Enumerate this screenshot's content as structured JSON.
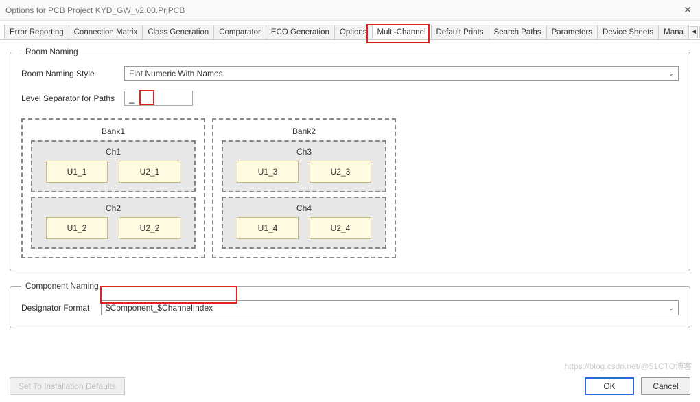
{
  "window": {
    "title": "Options for PCB Project KYD_GW_v2.00.PrjPCB"
  },
  "tabs": [
    "Error Reporting",
    "Connection Matrix",
    "Class Generation",
    "Comparator",
    "ECO Generation",
    "Options",
    "Multi-Channel",
    "Default Prints",
    "Search Paths",
    "Parameters",
    "Device Sheets",
    "Mana"
  ],
  "roomNaming": {
    "legend": "Room Naming",
    "styleLabel": "Room Naming Style",
    "styleValue": "Flat Numeric With Names",
    "sepLabel": "Level Separator for Paths",
    "sepValue": "_",
    "banks": [
      {
        "title": "Bank1",
        "channels": [
          {
            "title": "Ch1",
            "items": [
              "U1_1",
              "U2_1"
            ]
          },
          {
            "title": "Ch2",
            "items": [
              "U1_2",
              "U2_2"
            ]
          }
        ]
      },
      {
        "title": "Bank2",
        "channels": [
          {
            "title": "Ch3",
            "items": [
              "U1_3",
              "U2_3"
            ]
          },
          {
            "title": "Ch4",
            "items": [
              "U1_4",
              "U2_4"
            ]
          }
        ]
      }
    ]
  },
  "componentNaming": {
    "legend": "Component Naming",
    "formatLabel": "Designator Format",
    "formatValue": "$Component_$ChannelIndex"
  },
  "buttons": {
    "defaults": "Set To Installation Defaults",
    "ok": "OK",
    "cancel": "Cancel"
  },
  "watermark": "https://blog.csdn.net/@51CTO博客"
}
